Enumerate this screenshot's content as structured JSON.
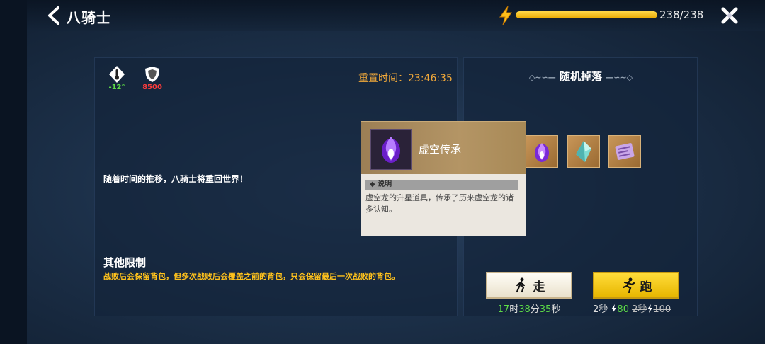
{
  "header": {
    "title": "八骑士",
    "energy_text": "238/238",
    "energy_fraction": 1.0
  },
  "stats": {
    "temperature": "-12°",
    "defense": "8500"
  },
  "reset": {
    "label": "重置时间：23:46:35"
  },
  "description": "随着时间的推移，八骑士将重回世界！",
  "limits": {
    "title": "其他限制",
    "text": "战败后会保留背包，但多次战败后会覆盖之前的背包，只会保留最后一次战败的背包。"
  },
  "drops": {
    "title": "随机掉落",
    "items": [
      "purple-flame-icon",
      "crystal-icon",
      "scroll-icon"
    ]
  },
  "tooltip": {
    "name": "虚空传承",
    "section_label": "说明",
    "text": "虚空龙的升星道具，传承了历来虚空龙的诸多认知。"
  },
  "actions": {
    "walk": {
      "label": "走",
      "h": "17",
      "h_unit": "时",
      "m": "38",
      "m_unit": "分",
      "s": "35",
      "s_unit": "秒"
    },
    "run": {
      "label": "跑",
      "time": "2秒",
      "cost": "80",
      "old_time": "2秒",
      "old_cost": "100"
    }
  },
  "colors": {
    "accent_gold": "#ffc21c",
    "green": "#5ddc47",
    "red": "#ff3b3b",
    "orange": "#f0a83a"
  }
}
